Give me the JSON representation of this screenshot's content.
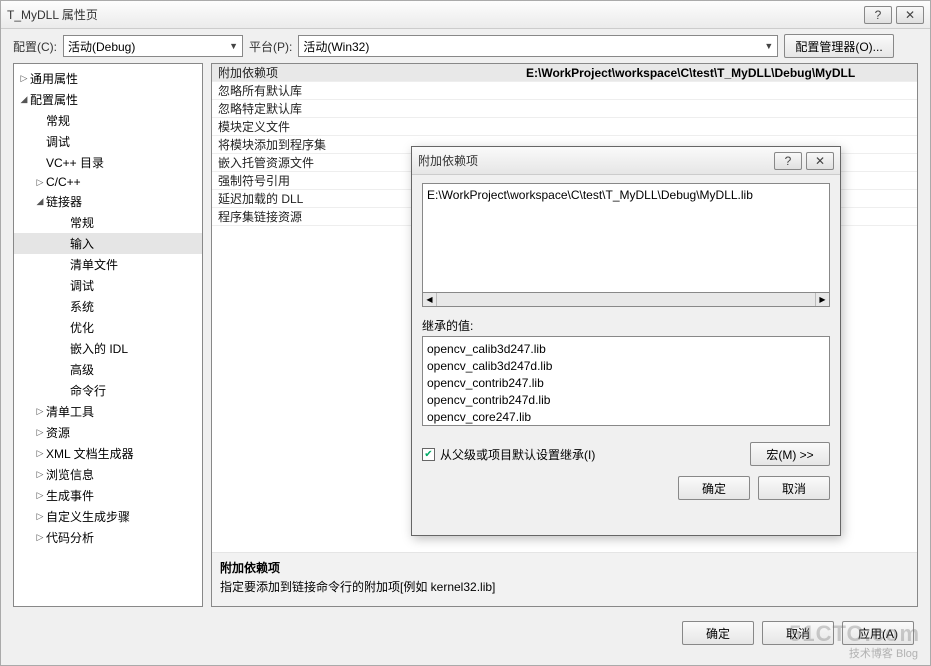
{
  "window": {
    "title": "T_MyDLL 属性页",
    "help_glyph": "?",
    "close_glyph": "✕"
  },
  "toolbar": {
    "config_label": "配置(C):",
    "config_value": "活动(Debug)",
    "platform_label": "平台(P):",
    "platform_value": "活动(Win32)",
    "manager_btn": "配置管理器(O)..."
  },
  "tree": [
    {
      "exp": "▷",
      "label": "通用属性",
      "depth": 0
    },
    {
      "exp": "◢",
      "label": "配置属性",
      "depth": 0
    },
    {
      "exp": "",
      "label": "常规",
      "depth": 1
    },
    {
      "exp": "",
      "label": "调试",
      "depth": 1
    },
    {
      "exp": "",
      "label": "VC++ 目录",
      "depth": 1
    },
    {
      "exp": "▷",
      "label": "C/C++",
      "depth": 1
    },
    {
      "exp": "◢",
      "label": "链接器",
      "depth": 1
    },
    {
      "exp": "",
      "label": "常规",
      "depth": 2
    },
    {
      "exp": "",
      "label": "输入",
      "depth": 2,
      "selected": true
    },
    {
      "exp": "",
      "label": "清单文件",
      "depth": 2
    },
    {
      "exp": "",
      "label": "调试",
      "depth": 2
    },
    {
      "exp": "",
      "label": "系统",
      "depth": 2
    },
    {
      "exp": "",
      "label": "优化",
      "depth": 2
    },
    {
      "exp": "",
      "label": "嵌入的 IDL",
      "depth": 2
    },
    {
      "exp": "",
      "label": "高级",
      "depth": 2
    },
    {
      "exp": "",
      "label": "命令行",
      "depth": 2
    },
    {
      "exp": "▷",
      "label": "清单工具",
      "depth": 1
    },
    {
      "exp": "▷",
      "label": "资源",
      "depth": 1
    },
    {
      "exp": "▷",
      "label": "XML 文档生成器",
      "depth": 1
    },
    {
      "exp": "▷",
      "label": "浏览信息",
      "depth": 1
    },
    {
      "exp": "▷",
      "label": "生成事件",
      "depth": 1
    },
    {
      "exp": "▷",
      "label": "自定义生成步骤",
      "depth": 1
    },
    {
      "exp": "▷",
      "label": "代码分析",
      "depth": 1
    }
  ],
  "props": [
    {
      "name": "附加依赖项",
      "value": "E:\\WorkProject\\workspace\\C\\test\\T_MyDLL\\Debug\\MyDLL",
      "selected": true
    },
    {
      "name": "忽略所有默认库",
      "value": ""
    },
    {
      "name": "忽略特定默认库",
      "value": ""
    },
    {
      "name": "模块定义文件",
      "value": ""
    },
    {
      "name": "将模块添加到程序集",
      "value": ""
    },
    {
      "name": "嵌入托管资源文件",
      "value": ""
    },
    {
      "name": "强制符号引用",
      "value": ""
    },
    {
      "name": "延迟加载的 DLL",
      "value": ""
    },
    {
      "name": "程序集链接资源",
      "value": ""
    }
  ],
  "desc": {
    "title": "附加依赖项",
    "text": "指定要添加到链接命令行的附加项[例如 kernel32.lib]"
  },
  "buttons": {
    "ok": "确定",
    "cancel": "取消",
    "apply": "应用(A)"
  },
  "modal": {
    "title": "附加依赖项",
    "help_glyph": "?",
    "close_glyph": "✕",
    "textbox_value": "E:\\WorkProject\\workspace\\C\\test\\T_MyDLL\\Debug\\MyDLL.lib",
    "inherit_label": "继承的值:",
    "inherited": [
      "opencv_calib3d247.lib",
      "opencv_calib3d247d.lib",
      "opencv_contrib247.lib",
      "opencv_contrib247d.lib",
      "opencv_core247.lib"
    ],
    "inherit_cb_label": "从父级或项目默认设置继承(I)",
    "inherit_checked": true,
    "macro_btn": "宏(M) >>",
    "ok": "确定",
    "cancel": "取消"
  },
  "watermark": {
    "line1": "51CTO.com",
    "line2": "技术博客  Blog"
  }
}
